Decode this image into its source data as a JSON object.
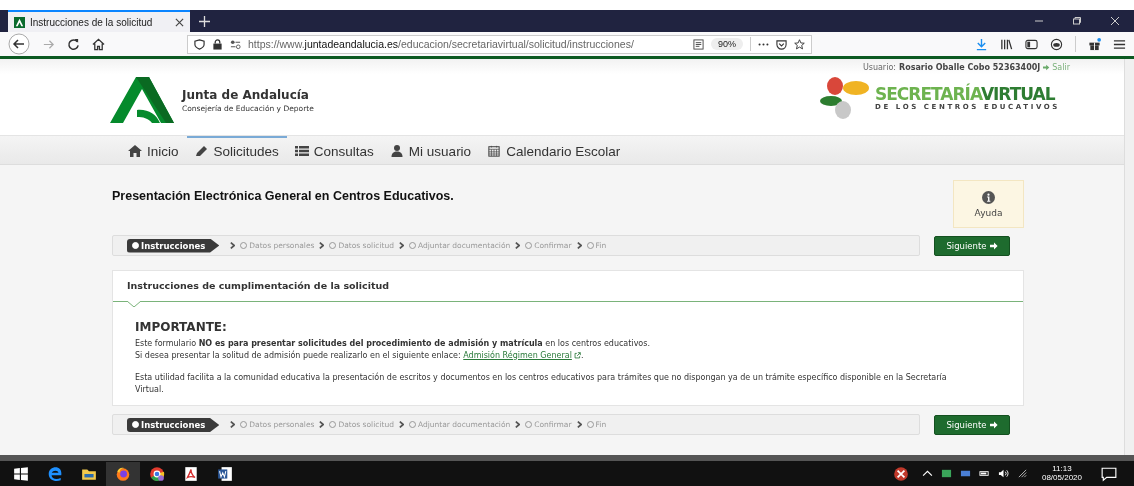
{
  "browser": {
    "tab_title": "Instrucciones de la solicitud",
    "url_prefix": "https://www.",
    "url_domain": "juntadeandalucia.es",
    "url_path": "/educacion/secretariavirtual/solicitud/instrucciones/",
    "zoom": "90%"
  },
  "header": {
    "user_label": "Usuario:",
    "user_name": "Rosario Oballe Cobo 52363400J",
    "logout": "Salir",
    "org_name": "Junta de Andalucía",
    "org_sub": "Consejería de Educación y Deporte",
    "brand_a": "SECRETARÍA",
    "brand_b": "VIRTUAL",
    "brand_sub": "DE LOS CENTROS EDUCATIVOS"
  },
  "nav": [
    {
      "label": "Inicio",
      "kind": "home",
      "selected": false
    },
    {
      "label": "Solicitudes",
      "kind": "requests",
      "selected": true
    },
    {
      "label": "Consultas",
      "kind": "queries",
      "selected": false
    },
    {
      "label": "Mi usuario",
      "kind": "account",
      "selected": false
    },
    {
      "label": "Calendario Escolar",
      "kind": "calendar",
      "selected": false
    }
  ],
  "page_title": "Presentación Electrónica General en Centros Educativos.",
  "help": "Ayuda",
  "steps_top": [
    {
      "label": "Instrucciones",
      "selected": true
    },
    {
      "label": "Datos personales",
      "selected": false
    },
    {
      "label": "Datos solicitud",
      "selected": false
    },
    {
      "label": "Adjuntar documentación",
      "selected": false
    },
    {
      "label": "Confirmar",
      "selected": false
    },
    {
      "label": "Fin",
      "selected": false
    }
  ],
  "next_top": "Siguiente",
  "panel": {
    "title": "Instrucciones de cumplimentación de la solicitud",
    "heading": "IMPORTANTE:",
    "p1": "Este formulario **NO es para presentar solicitudes del procedimiento de admisión y matrícula** en los centros educativos.",
    "p2_text": "Si desea presentar la solitud de admisión puede realizarlo en el siguiente enlace: ",
    "p2_link": "Admisión Régimen General",
    "p2_end": ".",
    "p3": "Esta utilidad facilita a la comunidad educativa la presentación de escritos y documentos en los centros educativos para trámites que no dispongan ya de un trámite específico disponible en la Secretaría Virtual."
  },
  "steps_bottom": [
    {
      "label": "Instrucciones",
      "selected": true
    },
    {
      "label": "Datos personales",
      "selected": false
    },
    {
      "label": "Datos solicitud",
      "selected": false
    },
    {
      "label": "Adjuntar documentación",
      "selected": false
    },
    {
      "label": "Confirmar",
      "selected": false
    },
    {
      "label": "Fin",
      "selected": false
    }
  ],
  "next_bottom": "Siguiente",
  "taskbar": {
    "time": "11:13",
    "date": "08/05/2020"
  }
}
